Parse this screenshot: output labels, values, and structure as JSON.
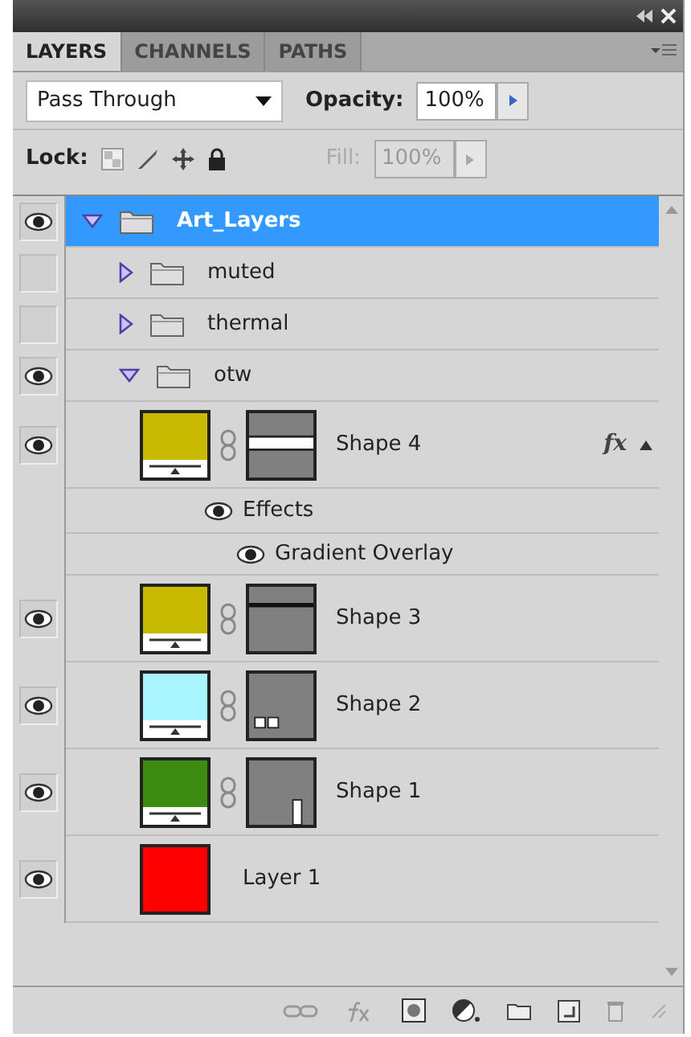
{
  "tabs": [
    {
      "label": "LAYERS",
      "selected": true
    },
    {
      "label": "CHANNELS",
      "selected": false
    },
    {
      "label": "PATHS",
      "selected": false
    }
  ],
  "blend_mode": "Pass Through",
  "opacity": {
    "label": "Opacity:",
    "value": "100%"
  },
  "lock": {
    "label": "Lock:"
  },
  "fill": {
    "label": "Fill:",
    "value": "100%",
    "disabled": true
  },
  "layers": [
    {
      "kind": "group",
      "name": "Art_Layers",
      "visible": true,
      "selected": true,
      "expanded": true,
      "children": [
        {
          "kind": "group",
          "name": "muted",
          "visible": false,
          "selected": false,
          "expanded": false
        },
        {
          "kind": "group",
          "name": "thermal",
          "visible": false,
          "selected": false,
          "expanded": false
        },
        {
          "kind": "group",
          "name": "otw",
          "visible": true,
          "selected": false,
          "expanded": true,
          "children": [
            {
              "kind": "shape",
              "name": "Shape 4",
              "visible": true,
              "selected": false,
              "color": "#c8ba00",
              "mask": {
                "kind": "band"
              },
              "fx": "fx",
              "effects_expanded": true,
              "effects": {
                "label": "Effects",
                "visible": true,
                "items": [
                  {
                    "name": "Gradient Overlay",
                    "visible": true
                  }
                ]
              }
            },
            {
              "kind": "shape",
              "name": "Shape 3",
              "visible": true,
              "selected": false,
              "color": "#c8ba00",
              "mask": {
                "kind": "line"
              }
            },
            {
              "kind": "shape",
              "name": "Shape 2",
              "visible": true,
              "selected": false,
              "color": "#a8f4ff",
              "mask": {
                "kind": "squares"
              }
            },
            {
              "kind": "shape",
              "name": "Shape 1",
              "visible": true,
              "selected": false,
              "color": "#3c8c12",
              "mask": {
                "kind": "door"
              }
            },
            {
              "kind": "pixel",
              "name": "Layer 1",
              "visible": true,
              "selected": false,
              "color": "#ff0000"
            }
          ]
        }
      ]
    }
  ]
}
